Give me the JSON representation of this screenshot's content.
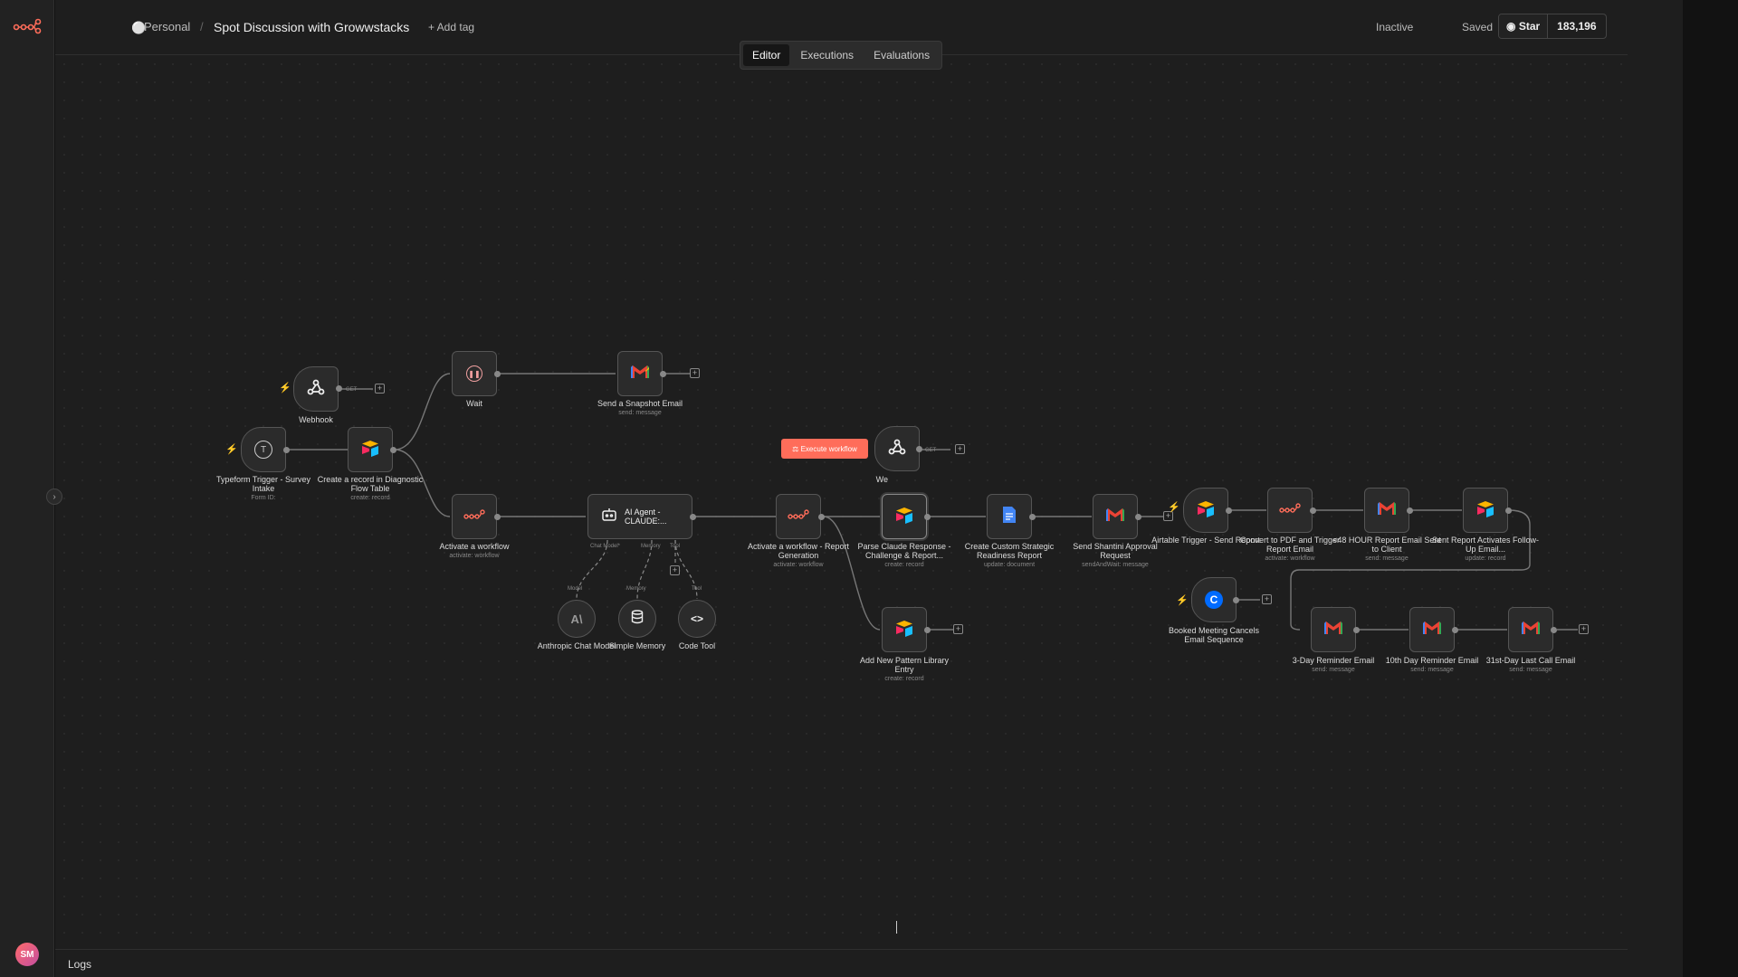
{
  "header": {
    "project": "Personal",
    "separator": "/",
    "workflow_title": "Spot Discussion with Growwstacks",
    "add_tag": "+ Add tag",
    "status": "Inactive",
    "save_state": "Saved",
    "star_label": "Star",
    "star_count": "183,196"
  },
  "tabs": [
    "Editor",
    "Executions",
    "Evaluations"
  ],
  "active_tab": "Editor",
  "sidebar": {
    "avatar_initials": "SM",
    "expand_icon": "›"
  },
  "logs_label": "Logs",
  "execute_button": "Execute workflow",
  "nodes": [
    {
      "id": "webhook1",
      "label": "Webhook",
      "sub": "",
      "icon": "webhook-icon"
    },
    {
      "id": "typeform",
      "label": "Typeform Trigger - Survey Intake",
      "sub": "Form ID:",
      "icon": "typeform-icon"
    },
    {
      "id": "airtable1",
      "label": "Create a record in Diagnostic Flow Table",
      "sub": "create: record",
      "icon": "airtable-icon"
    },
    {
      "id": "wait",
      "label": "Wait",
      "sub": "",
      "icon": "pause-icon"
    },
    {
      "id": "gmail_snapshot",
      "label": "Send a Snapshot Email",
      "sub": "send: message",
      "icon": "gmail-icon"
    },
    {
      "id": "activate1",
      "label": "Activate a workflow",
      "sub": "activate: workflow",
      "icon": "n8n-icon"
    },
    {
      "id": "agent",
      "label": "AI Agent - CLAUDE:...",
      "sub": "",
      "icon": "robot-icon"
    },
    {
      "id": "anthropic",
      "label": "Anthropic Chat Model",
      "sub": "",
      "icon": "anthropic-icon"
    },
    {
      "id": "memory",
      "label": "Simple Memory",
      "sub": "",
      "icon": "database-icon"
    },
    {
      "id": "codetool",
      "label": "Code Tool",
      "sub": "",
      "icon": "code-icon"
    },
    {
      "id": "activate2",
      "label": "Activate a workflow - Report Generation",
      "sub": "activate: workflow",
      "icon": "n8n-icon"
    },
    {
      "id": "webhook2",
      "label": "We",
      "sub": "",
      "icon": "webhook-icon"
    },
    {
      "id": "parse",
      "label": "Parse Claude Response - Challenge & Report...",
      "sub": "create: record",
      "icon": "airtable-icon"
    },
    {
      "id": "pattern",
      "label": "Add New Pattern Library Entry",
      "sub": "create: record",
      "icon": "airtable-icon"
    },
    {
      "id": "gdoc",
      "label": "Create Custom Strategic Readiness Report",
      "sub": "update: document",
      "icon": "gdocs-icon"
    },
    {
      "id": "approval",
      "label": "Send Shantini Approval Request",
      "sub": "sendAndWait: message",
      "icon": "gmail-icon"
    },
    {
      "id": "airtrig",
      "label": "Airtable Trigger - Send Report",
      "sub": "",
      "icon": "airtable-icon"
    },
    {
      "id": "pdf",
      "label": "Convert to PDF and Trigger Report Email",
      "sub": "activate: workflow",
      "icon": "n8n-icon"
    },
    {
      "id": "h48",
      "label": "<48 HOUR Report Email Sent to Client",
      "sub": "send: message",
      "icon": "gmail-icon"
    },
    {
      "id": "followup",
      "label": "Sent Report Activates Follow-Up Email...",
      "sub": "update: record",
      "icon": "airtable-icon"
    },
    {
      "id": "calendly",
      "label": "Booked Meeting Cancels Email Sequence",
      "sub": "",
      "icon": "calendly-icon"
    },
    {
      "id": "d3",
      "label": "3-Day Reminder Email",
      "sub": "send: message",
      "icon": "gmail-icon"
    },
    {
      "id": "d10",
      "label": "10th Day Reminder Email",
      "sub": "send: message",
      "icon": "gmail-icon"
    },
    {
      "id": "d31",
      "label": "31st-Day Last Call Email",
      "sub": "send: message",
      "icon": "gmail-icon"
    }
  ],
  "connector_tags": {
    "get1": "GET",
    "get2": "GET",
    "chat_model": "Chat Model*",
    "memory": "Memory",
    "tool": "Tool",
    "model_in": "Model",
    "memory_in": "Memory",
    "tool_in": "Tool"
  },
  "colors": {
    "accent": "#ff6d5a",
    "canvas": "#1e1e1e",
    "node": "#2b2b2b"
  }
}
